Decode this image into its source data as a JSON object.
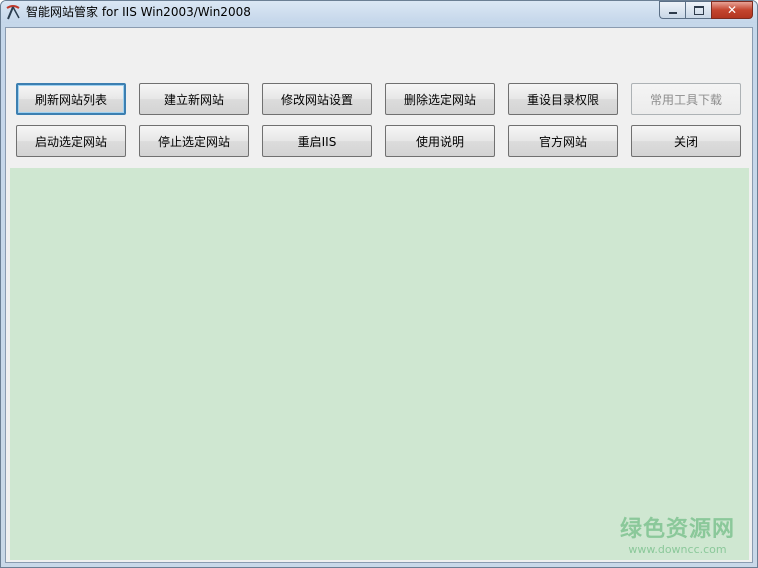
{
  "window": {
    "title": "智能网站管家 for IIS Win2003/Win2008",
    "icon": "pickaxe-icon",
    "caption_buttons": {
      "minimize": "minimize-icon",
      "maximize": "maximize-icon",
      "close": "✕"
    }
  },
  "toolbar": {
    "row1": [
      {
        "label": "刷新网站列表",
        "enabled": true,
        "focused": true
      },
      {
        "label": "建立新网站",
        "enabled": true
      },
      {
        "label": "修改网站设置",
        "enabled": true
      },
      {
        "label": "删除选定网站",
        "enabled": true
      },
      {
        "label": "重设目录权限",
        "enabled": true
      },
      {
        "label": "常用工具下载",
        "enabled": false
      }
    ],
    "row2": [
      {
        "label": "启动选定网站",
        "enabled": true
      },
      {
        "label": "停止选定网站",
        "enabled": true
      },
      {
        "label": "重启IIS",
        "enabled": true
      },
      {
        "label": "使用说明",
        "enabled": true
      },
      {
        "label": "官方网站",
        "enabled": true
      },
      {
        "label": "关闭",
        "enabled": true
      }
    ]
  },
  "watermark": {
    "text": "绿色资源网",
    "url": "www.downcc.com"
  },
  "colors": {
    "panel": "#cfe7d1",
    "watermark": "#8bc89a",
    "close_button": "#c4452f"
  }
}
